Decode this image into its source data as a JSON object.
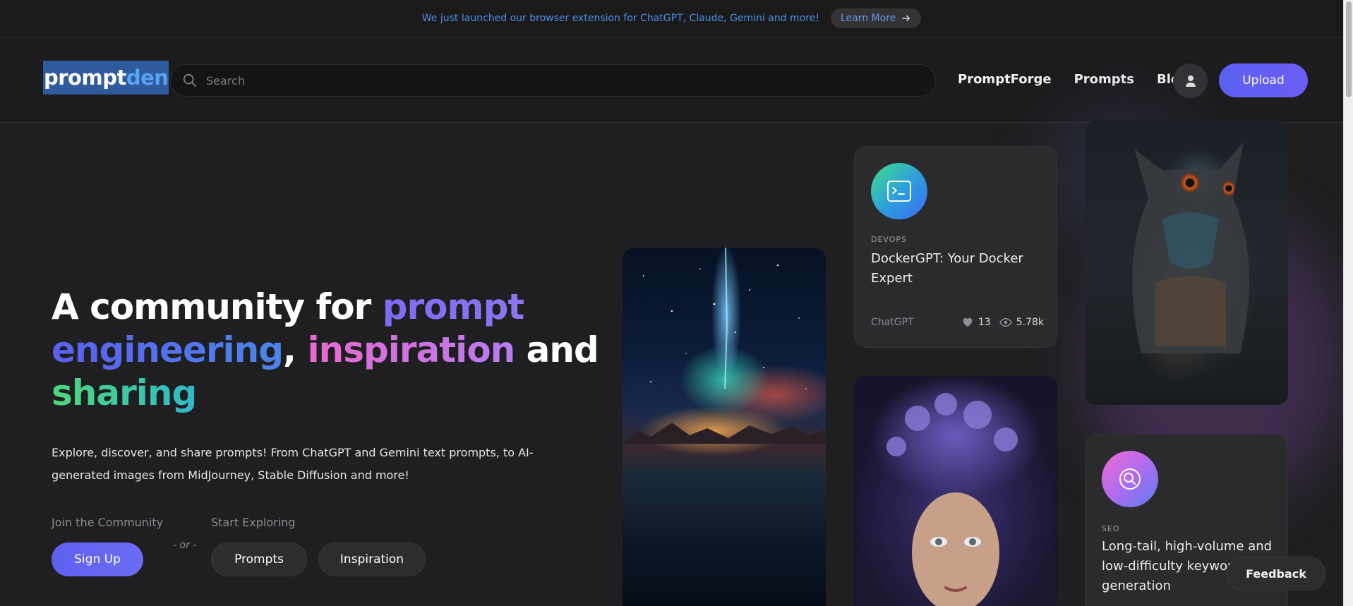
{
  "announcement": {
    "text": "We just launched our browser extension for ChatGPT, Claude, Gemini and more!",
    "button": "Learn More"
  },
  "header": {
    "logo_prompt": "prompt",
    "logo_den": "den",
    "search_placeholder": "Search",
    "nav": [
      "PromptForge",
      "Prompts",
      "Blog"
    ],
    "upload": "Upload"
  },
  "hero": {
    "title_1": "A community for ",
    "title_prompt": "prompt",
    "title_engineering": "engineering",
    "title_comma": ", ",
    "title_inspiration": "inspiration",
    "title_and": " and",
    "title_sharing": "sharing",
    "description": "Explore, discover, and share prompts! From ChatGPT and Gemini text prompts, to AI-generated images from MidJourney, Stable Diffusion and more!",
    "join_label": "Join the Community",
    "start_label": "Start Exploring",
    "or": "- or -",
    "signup": "Sign Up",
    "prompts": "Prompts",
    "inspiration": "Inspiration"
  },
  "cards": {
    "docker": {
      "category": "DEVOPS",
      "title": "DockerGPT: Your Docker Expert",
      "model": "ChatGPT",
      "likes": "13",
      "views": "5.78k",
      "icon": "terminal-icon"
    },
    "seo": {
      "category": "SEO",
      "title": "Long-tail, high-volume and low-difficulty keywords generation",
      "icon": "search-icon"
    }
  },
  "feedback": "Feedback",
  "colors": {
    "accent": "#6366f1",
    "announce_text": "#4f8fe8",
    "background": "#1f1f21"
  }
}
